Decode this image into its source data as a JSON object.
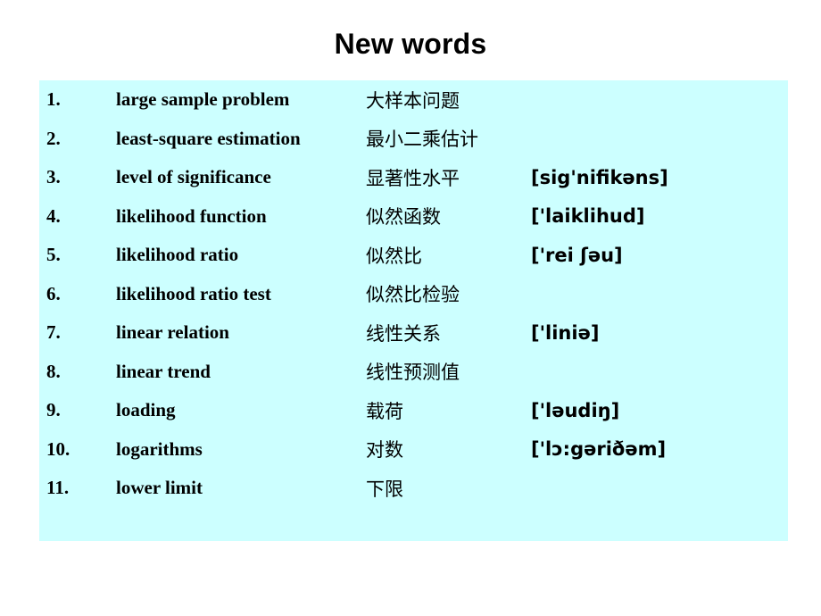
{
  "slide": {
    "title": "New words",
    "panel_color": "#ccffff",
    "text_color": "#000000",
    "background_color": "#ffffff"
  },
  "words": [
    {
      "index": "1.",
      "term": "large sample problem",
      "chinese": "大样本问题",
      "ipa": ""
    },
    {
      "index": "2.",
      "term": "least-square estimation",
      "chinese": "最小二乘估计",
      "ipa": ""
    },
    {
      "index": "3.",
      "term": "level of significance",
      "chinese": "显著性水平",
      "ipa": "[sig'nifikəns]"
    },
    {
      "index": "4.",
      "term": "likelihood function",
      "chinese": "似然函数",
      "ipa": "['laiklihud]"
    },
    {
      "index": "5.",
      "term": "likelihood ratio",
      "chinese": "似然比",
      "ipa": "['rei ʃəu]"
    },
    {
      "index": "6.",
      "term": "likelihood ratio test",
      "chinese": "似然比检验",
      "ipa": ""
    },
    {
      "index": "7.",
      "term": "linear relation",
      "chinese": "线性关系",
      "ipa": "['liniə]"
    },
    {
      "index": "8.",
      "term": "linear trend",
      "chinese": "线性预测值",
      "ipa": ""
    },
    {
      "index": "9.",
      "term": "loading",
      "chinese": "载荷",
      "ipa": "['ləudiŋ]"
    },
    {
      "index": "10.",
      "term": "logarithms",
      "chinese": "对数",
      "ipa": "['lɔ:gəriðəm]"
    },
    {
      "index": "11.",
      "term": "lower limit",
      "chinese": "下限",
      "ipa": ""
    }
  ]
}
